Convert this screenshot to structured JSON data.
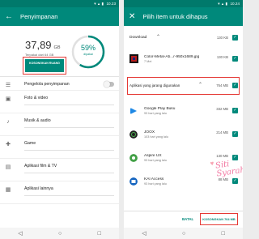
{
  "left": {
    "status_time": "10.23",
    "title": "Penyimpanan",
    "used_value": "37,89",
    "used_unit": "GB",
    "used_caption": "Terpakai dari 64 GB",
    "free_button": "KOSONGKAN RUANG",
    "ring_percent": "59%",
    "ring_label": "dipakai",
    "ring_fraction": 0.59,
    "rows": [
      {
        "label": "Pengelola penyimpanan",
        "icon": "storage-manager-icon"
      },
      {
        "label": "Foto & video",
        "icon": "photo-icon"
      },
      {
        "label": "Musik & audio",
        "icon": "music-icon"
      },
      {
        "label": "Game",
        "icon": "gamepad-icon"
      },
      {
        "label": "Aplikasi film & TV",
        "icon": "movie-icon"
      },
      {
        "label": "Aplikasi lainnya",
        "icon": "apps-icon"
      }
    ]
  },
  "right": {
    "status_time": "10.24",
    "title": "Pilih item untuk dihapus",
    "download_section": {
      "label": "Download",
      "size": "130 KB"
    },
    "download_file": {
      "name": "Color-Metal-Ab...r-950x1689.jpg",
      "sub": "7 Mei",
      "size": "130 KB"
    },
    "apps_section": {
      "label": "Aplikasi yang jarang digunakan",
      "size": "764 MB"
    },
    "apps": [
      {
        "name": "Google Play Buku",
        "sub": "93 hari yang lalu",
        "size": "332 MB",
        "color": "#1e88e5"
      },
      {
        "name": "JOOX",
        "sub": "103 hari yang lalu",
        "size": "214 MB",
        "color": "#212121"
      },
      {
        "name": "Aspire UX",
        "sub": "93 hari yang lalu",
        "size": "130 MB",
        "color": "#43a047"
      },
      {
        "name": "KAI Access",
        "sub": "93 hari yang lalu",
        "size": "88 MB",
        "color": "#1565c0"
      }
    ],
    "watermark": "Siti Syarah",
    "cancel_button": "BATAL",
    "free_button": "KOSONGKAN 764 MB"
  },
  "colors": {
    "accent": "#00897b",
    "highlight": "#e53935"
  }
}
